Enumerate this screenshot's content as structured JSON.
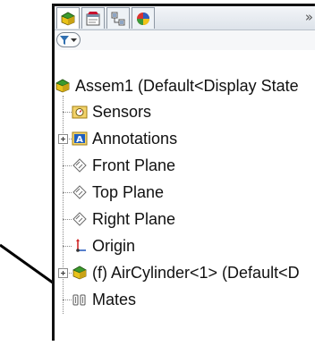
{
  "tabs": [
    {
      "name": "featuremanager",
      "icon": "featuremanager-tab-icon",
      "active": true
    },
    {
      "name": "propertymanager",
      "icon": "propertymanager-tab-icon",
      "active": false
    },
    {
      "name": "configurationmanager",
      "icon": "configurationmanager-tab-icon",
      "active": false
    },
    {
      "name": "displaymanager",
      "icon": "displaymanager-tab-icon",
      "active": false
    }
  ],
  "more_tabs": "»",
  "filter": {
    "icon": "filter-icon",
    "dropdown": "chevron-down-icon"
  },
  "tree": {
    "root": "Assem1  (Default<Display State",
    "sensors": "Sensors",
    "annotations": "Annotations",
    "front_plane": "Front Plane",
    "top_plane": "Top Plane",
    "right_plane": "Right Plane",
    "origin": "Origin",
    "component": "(f) AirCylinder<1> (Default<D",
    "mates": "Mates"
  },
  "colors": {
    "frame": "#111111",
    "assembly_green": "#3c9a2e",
    "assembly_yellow": "#e8c21a",
    "folder_yellow": "#f3d36b",
    "annotation_blue": "#1f5fbf",
    "origin_red": "#d12a2a",
    "plane_gray": "#6b6b6b"
  }
}
